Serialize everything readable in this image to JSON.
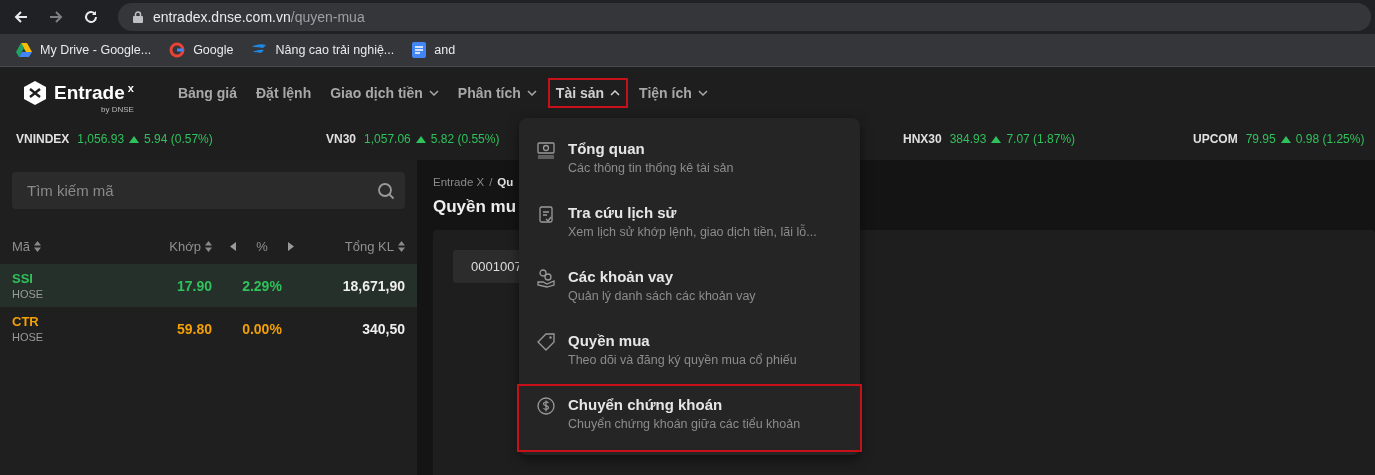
{
  "browser": {
    "url_host": "entradex.dnse.com.vn",
    "url_path": "/quyen-mua",
    "bookmarks": [
      {
        "label": "My Drive - Google..."
      },
      {
        "label": "Google"
      },
      {
        "label": "Nâng cao trải nghiệ..."
      },
      {
        "label": "and"
      }
    ]
  },
  "app_nav": {
    "logo": "Entrade",
    "logo_mark": "x",
    "logo_sub": "by DNSE",
    "items": [
      {
        "label": "Bảng giá",
        "has_caret": false,
        "expanded": false,
        "highlighted": false
      },
      {
        "label": "Đặt lệnh",
        "has_caret": false,
        "expanded": false,
        "highlighted": false
      },
      {
        "label": "Giao dịch tiền",
        "has_caret": true,
        "expanded": false,
        "highlighted": false
      },
      {
        "label": "Phân tích",
        "has_caret": true,
        "expanded": false,
        "highlighted": false
      },
      {
        "label": "Tài sản",
        "has_caret": true,
        "expanded": true,
        "highlighted": true
      },
      {
        "label": "Tiện ích",
        "has_caret": true,
        "expanded": false,
        "highlighted": false
      }
    ]
  },
  "ticker": [
    {
      "name": "VNINDEX",
      "value": "1,056.93",
      "change": "5.94 (0.57%)"
    },
    {
      "name": "VN30",
      "value": "1,057.06",
      "change": "5.82 (0.55%)"
    },
    {
      "name": "HNX30",
      "value": "384.93",
      "change": "7.07 (1.87%)"
    },
    {
      "name": "UPCOM",
      "value": "79.95",
      "change": "0.98 (1.25%)"
    }
  ],
  "search": {
    "placeholder": "Tìm kiếm mã"
  },
  "watchlist": {
    "columns": [
      {
        "label": "Mã",
        "kind": "sort"
      },
      {
        "label": "Khớp",
        "kind": "sort"
      },
      {
        "label": "%",
        "kind": "pager"
      },
      {
        "label": "Tổng KL",
        "kind": "sort"
      }
    ],
    "rows": [
      {
        "symbol": "SSI",
        "exchange": "HOSE",
        "price": "17.90",
        "percent": "2.29%",
        "volume": "18,671,90",
        "color": "#2fc15b",
        "selected": true
      },
      {
        "symbol": "CTR",
        "exchange": "HOSE",
        "price": "59.80",
        "percent": "0.00%",
        "volume": "340,50",
        "color": "#f2a007",
        "selected": false
      }
    ]
  },
  "content": {
    "breadcrumb": [
      "Entrade X",
      "Qu"
    ],
    "breadcrumb_separator": "/",
    "title": "Quyền mu",
    "account": "0001007"
  },
  "menu": {
    "items": [
      {
        "title": "Tổng quan",
        "subtitle": "Các thông tin thống kê tài sản",
        "highlighted": false
      },
      {
        "title": "Tra cứu lịch sử",
        "subtitle": "Xem lịch sử khớp lệnh, giao dịch tiền, lãi lỗ...",
        "highlighted": false
      },
      {
        "title": "Các khoản vay",
        "subtitle": "Quản lý danh sách các khoản vay",
        "highlighted": false
      },
      {
        "title": "Quyền mua",
        "subtitle": "Theo dõi và đăng ký quyền mua cổ phiếu",
        "highlighted": false
      },
      {
        "title": "Chuyển chứng khoán",
        "subtitle": "Chuyển chứng khoán giữa các tiểu khoản",
        "highlighted": true
      }
    ]
  }
}
